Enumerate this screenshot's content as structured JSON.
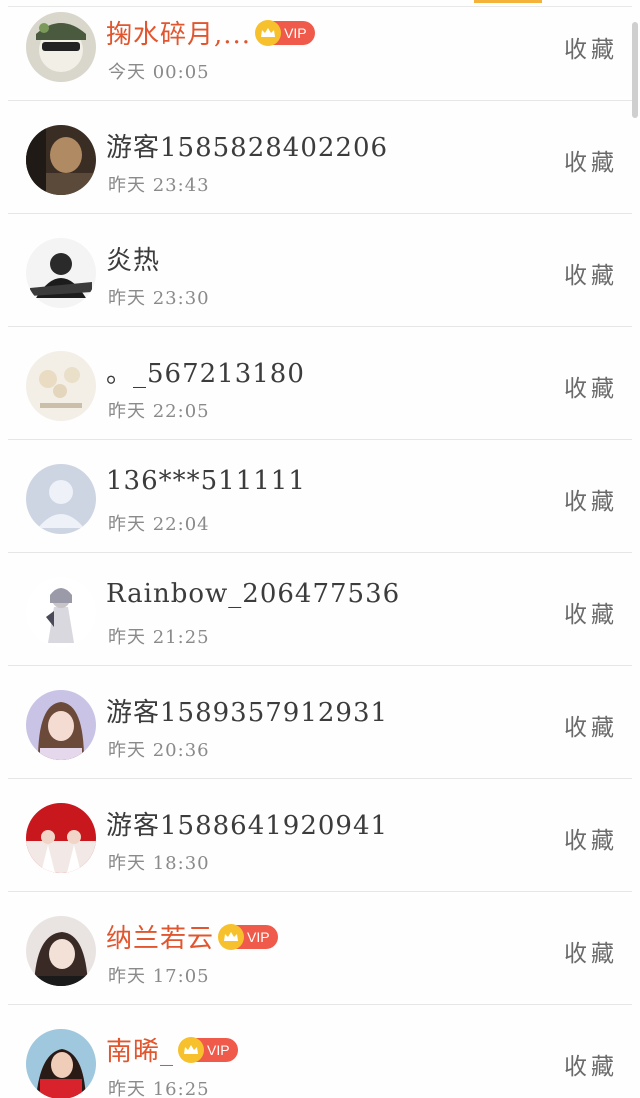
{
  "favorite_label": "收藏",
  "vip_label": "VIP",
  "colors": {
    "accent": "#f4b23a",
    "vip_name": "#e1562f",
    "vip_badge": "#ef5a4a"
  },
  "users": [
    {
      "name": "掬水碎月,...",
      "time": "今天 00:05",
      "vip": true
    },
    {
      "name": "游客1585828402206",
      "time": "昨天 23:43",
      "vip": false
    },
    {
      "name": "炎热",
      "time": "昨天 23:30",
      "vip": false
    },
    {
      "name": "。_567213180",
      "time": "昨天 22:05",
      "vip": false
    },
    {
      "name": "136***511111",
      "time": "昨天 22:04",
      "vip": false
    },
    {
      "name": "Rainbow_206477536",
      "time": "昨天 21:25",
      "vip": false
    },
    {
      "name": "游客1589357912931",
      "time": "昨天 20:36",
      "vip": false
    },
    {
      "name": "游客1588641920941",
      "time": "昨天 18:30",
      "vip": false
    },
    {
      "name": "纳兰若云",
      "time": "昨天 17:05",
      "vip": true
    },
    {
      "name": "南晞_",
      "time": "昨天 16:25",
      "vip": true
    }
  ]
}
